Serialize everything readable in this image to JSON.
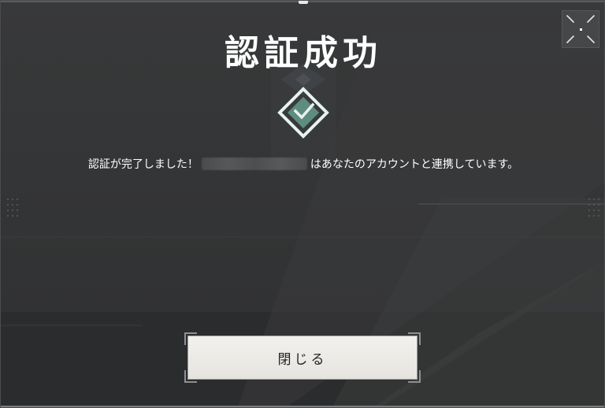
{
  "dialog": {
    "title": "認証成功",
    "message_prefix": "認証が完了しました！",
    "message_suffix": "はあなたのアカウントと連携しています。",
    "close_label": "閉じる"
  },
  "icons": {
    "fullscreen": "fullscreen-toggle-icon",
    "success": "check-diamond-icon"
  },
  "colors": {
    "background": "#333435",
    "title": "#ffffff",
    "emblem_fill": "#5e8c80",
    "emblem_outline": "#e8f2ee",
    "button_bg": "#ecebe7",
    "button_text": "#222222"
  }
}
